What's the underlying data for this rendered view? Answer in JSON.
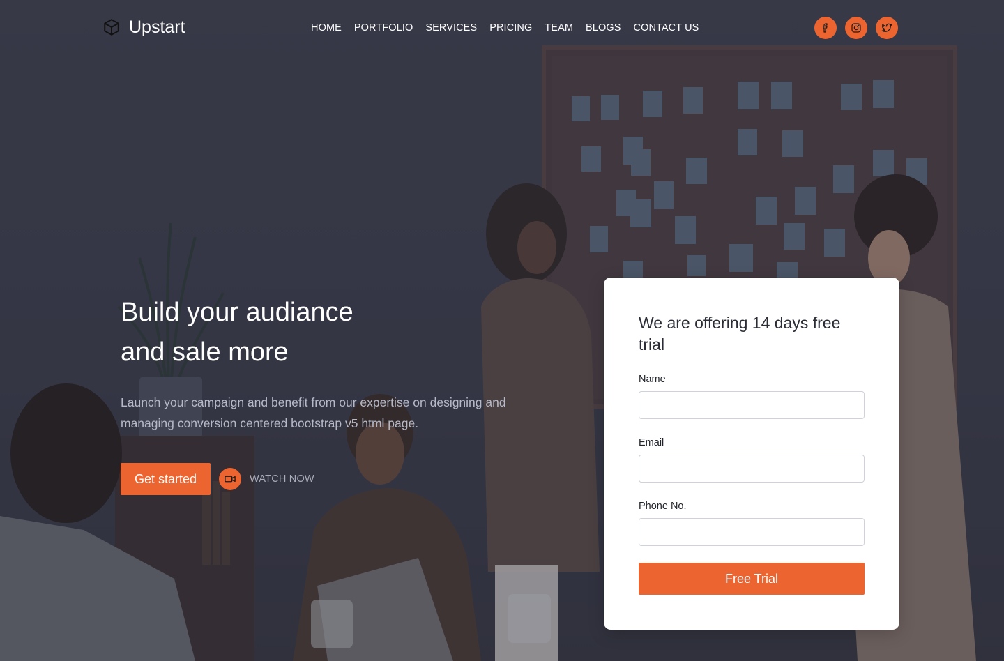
{
  "brand": {
    "name": "Upstart",
    "icon": "cube-icon"
  },
  "nav": {
    "items": [
      {
        "label": "HOME"
      },
      {
        "label": "PORTFOLIO"
      },
      {
        "label": "SERVICES"
      },
      {
        "label": "PRICING"
      },
      {
        "label": "TEAM"
      },
      {
        "label": "BLOGS"
      },
      {
        "label": "CONTACT US"
      }
    ]
  },
  "socials": [
    {
      "icon": "facebook-icon"
    },
    {
      "icon": "instagram-icon"
    },
    {
      "icon": "twitter-icon"
    }
  ],
  "hero": {
    "title_line1": "Build your audiance",
    "title_line2": "and sale more",
    "subtitle": "Launch your campaign and benefit from our expertise on designing and managing conversion centered bootstrap v5 html page.",
    "cta_primary": "Get started",
    "cta_secondary": "WATCH NOW",
    "cta_secondary_icon": "video-camera-icon"
  },
  "form": {
    "title": "We are offering 14 days free trial",
    "fields": {
      "name": {
        "label": "Name",
        "value": "",
        "placeholder": ""
      },
      "email": {
        "label": "Email",
        "value": "",
        "placeholder": ""
      },
      "phone": {
        "label": "Phone No.",
        "value": "",
        "placeholder": ""
      }
    },
    "submit": "Free Trial"
  },
  "colors": {
    "accent": "#ec6531",
    "overlay": "#3d3e4d",
    "text_light": "#ffffff",
    "text_muted": "#b6b9c8"
  }
}
